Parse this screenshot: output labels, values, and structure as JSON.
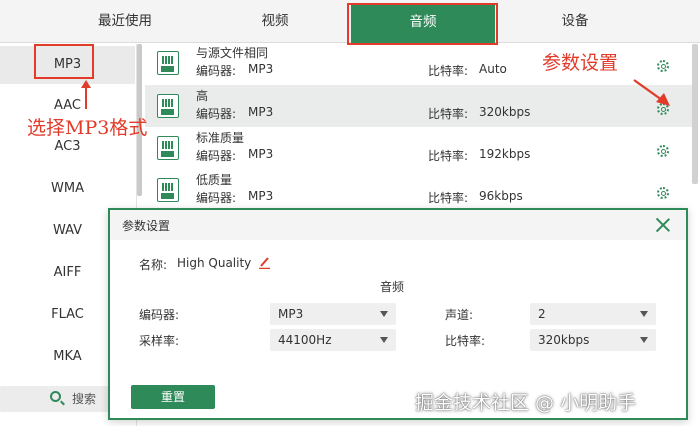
{
  "tabs": [
    {
      "label": "最近使用"
    },
    {
      "label": "视频"
    },
    {
      "label": "音频"
    },
    {
      "label": "设备"
    }
  ],
  "sidebar": {
    "formats": [
      {
        "label": "MP3"
      },
      {
        "label": "AAC"
      },
      {
        "label": "AC3"
      },
      {
        "label": "WMA"
      },
      {
        "label": "WAV"
      },
      {
        "label": "AIFF"
      },
      {
        "label": "FLAC"
      },
      {
        "label": "MKA"
      }
    ],
    "search_label": "搜索"
  },
  "presets": [
    {
      "name": "与源文件相同",
      "encoder_label": "编码器:",
      "encoder": "MP3",
      "bitrate_label": "比特率:",
      "bitrate": "Auto",
      "icon": "audio-file-icon"
    },
    {
      "name": "高",
      "encoder_label": "编码器:",
      "encoder": "MP3",
      "bitrate_label": "比特率:",
      "bitrate": "320kbps",
      "icon": "audio-quality-high-icon"
    },
    {
      "name": "标准质量",
      "encoder_label": "编码器:",
      "encoder": "MP3",
      "bitrate_label": "比特率:",
      "bitrate": "192kbps",
      "icon": "audio-quality-medium-icon"
    },
    {
      "name": "低质量",
      "encoder_label": "编码器:",
      "encoder": "MP3",
      "bitrate_label": "比特率:",
      "bitrate": "96kbps",
      "icon": "audio-quality-low-icon"
    }
  ],
  "annotations": {
    "format_hint": "选择MP3格式",
    "params_hint": "参数设置"
  },
  "dialog": {
    "title": "参数设置",
    "name_label": "名称:",
    "name_value": "High Quality",
    "section_title": "音频",
    "encoder_label": "编码器:",
    "encoder_value": "MP3",
    "channel_label": "声道:",
    "channel_value": "2",
    "samplerate_label": "采样率:",
    "samplerate_value": "44100Hz",
    "bitrate_label": "比特率:",
    "bitrate_value": "320kbps",
    "reset_label": "重置"
  },
  "watermark": "掘金技术社区 @ 小明助手",
  "colors": {
    "accent": "#2f8a5a",
    "annotation": "#e23b2a",
    "tab_bar": "#f3f4f3",
    "selected_row": "#e9ecea"
  }
}
